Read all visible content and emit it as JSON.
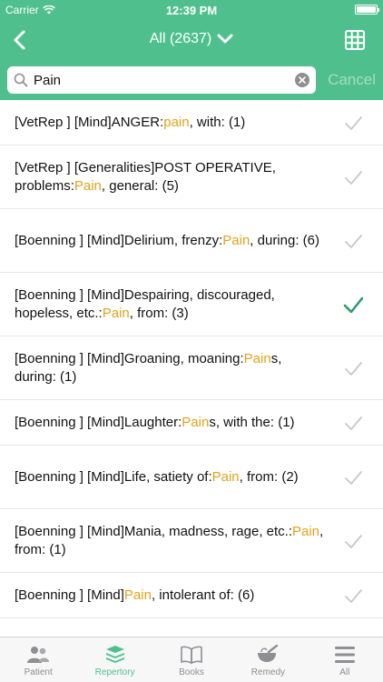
{
  "status_bar": {
    "carrier": "Carrier",
    "time": "12:39 PM"
  },
  "nav": {
    "title": "All (2637)"
  },
  "search": {
    "value": "Pain",
    "cancel_label": "Cancel"
  },
  "colors": {
    "accent": "#4fc08d",
    "highlight": "#e3a21a",
    "check_active": "#2e9c6a",
    "check_inactive": "#c8c8c8"
  },
  "results": [
    {
      "before": "[VetRep ] [Mind]ANGER:",
      "match": "pain",
      "after": ", with: (1)",
      "checked": false
    },
    {
      "before": "[VetRep ] [Generalities]POST OPERATIVE, problems:",
      "match": "Pain",
      "after": ", general: (5)",
      "checked": false
    },
    {
      "before": "[Boenning ] [Mind]Delirium, frenzy:",
      "match": "Pain",
      "after": ", during: (6)",
      "checked": false
    },
    {
      "before": "[Boenning ] [Mind]Despairing, discouraged, hopeless, etc.:",
      "match": "Pain",
      "after": ", from: (3)",
      "checked": true
    },
    {
      "before": "[Boenning ] [Mind]Groaning, moaning:",
      "match": "Pain",
      "after": "s, during: (1)",
      "checked": false
    },
    {
      "before": "[Boenning ] [Mind]Laughter:",
      "match": "Pain",
      "after": "s, with the: (1)",
      "checked": false
    },
    {
      "before": "[Boenning ] [Mind]Life, satiety of:",
      "match": "Pain",
      "after": ", from: (2)",
      "checked": false
    },
    {
      "before": "[Boenning ] [Mind]Mania, madness, rage, etc.:",
      "match": "Pain",
      "after": ", from: (1)",
      "checked": false
    },
    {
      "before": "[Boenning ] [Mind]",
      "match": "Pain",
      "after": ", intolerant of: (6)",
      "checked": false
    }
  ],
  "tabs": [
    {
      "label": "Patient",
      "icon": "patient-icon",
      "active": false
    },
    {
      "label": "Repertory",
      "icon": "repertory-icon",
      "active": true
    },
    {
      "label": "Books",
      "icon": "books-icon",
      "active": false
    },
    {
      "label": "Remedy",
      "icon": "remedy-icon",
      "active": false
    },
    {
      "label": "All",
      "icon": "menu-icon",
      "active": false
    }
  ]
}
